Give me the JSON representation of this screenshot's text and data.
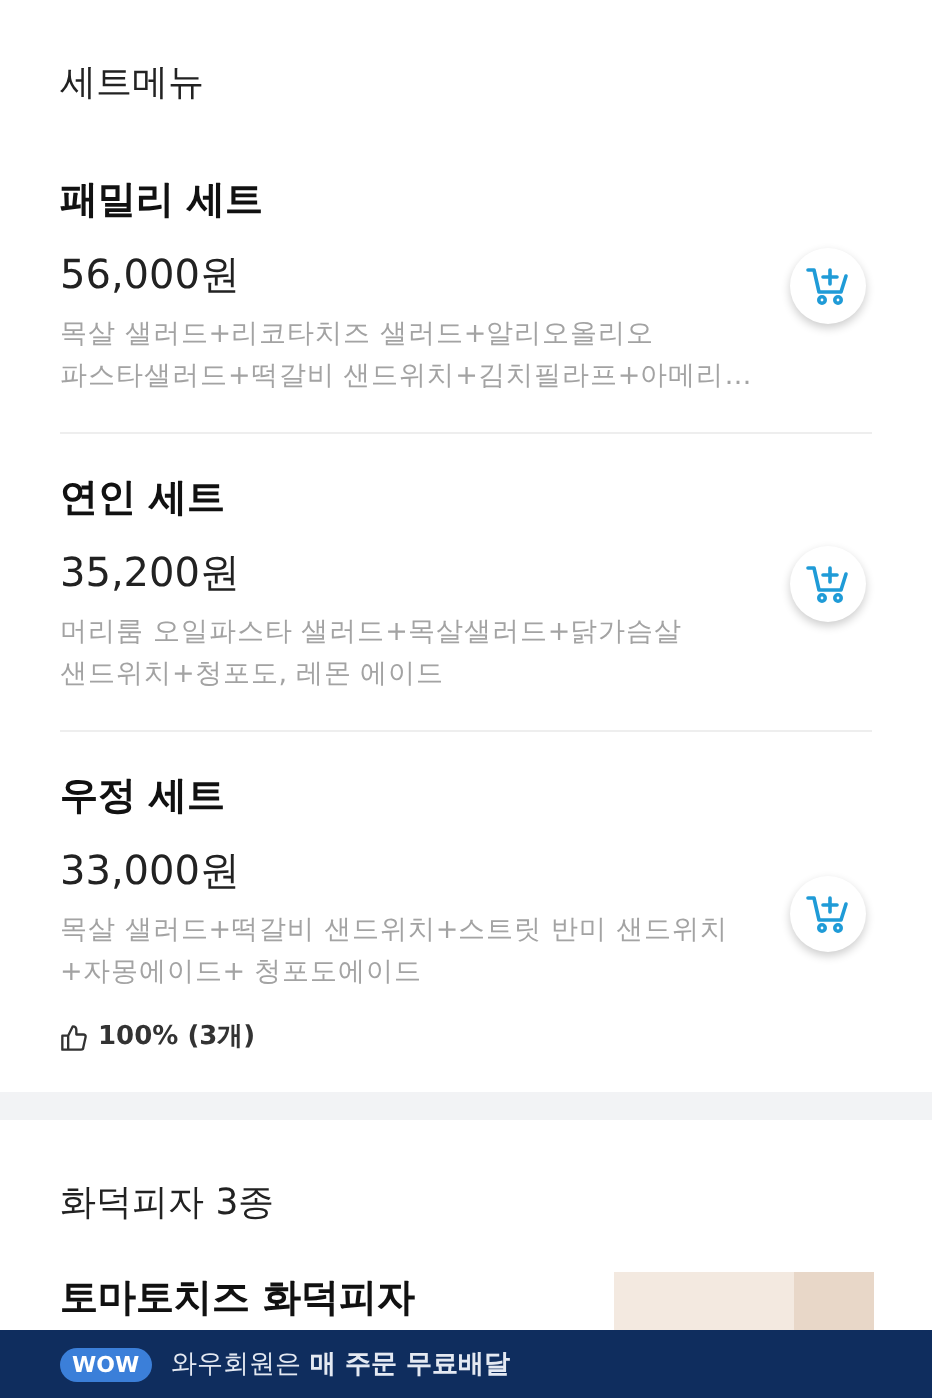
{
  "sections": [
    {
      "title": "세트메뉴",
      "items": [
        {
          "name": "패밀리 세트",
          "price": "56,000원",
          "description": "목살 샐러드+리코타치즈 샐러드+알리오올리오 파스타샐러드+떡갈비 샌드위치+김치필라프+아메리…"
        },
        {
          "name": "연인 세트",
          "price": "35,200원",
          "description": "머리룸 오일파스타 샐러드+목살샐러드+닭가슴살 샌드위치+청포도, 레몬 에이드"
        },
        {
          "name": "우정 세트",
          "price": "33,000원",
          "description": "목살 샐러드+떡갈비 샌드위치+스트릿 반미 샌드위치 +자몽에이드+ 청포도에이드",
          "rating": "100% (3개)"
        }
      ]
    },
    {
      "title": "화덕피자 3종",
      "items": [
        {
          "name": "토마토치즈 화덕피자"
        }
      ]
    }
  ],
  "banner": {
    "badge": "WOW",
    "text": "와우회원은 **매 주문 무료배달**"
  }
}
